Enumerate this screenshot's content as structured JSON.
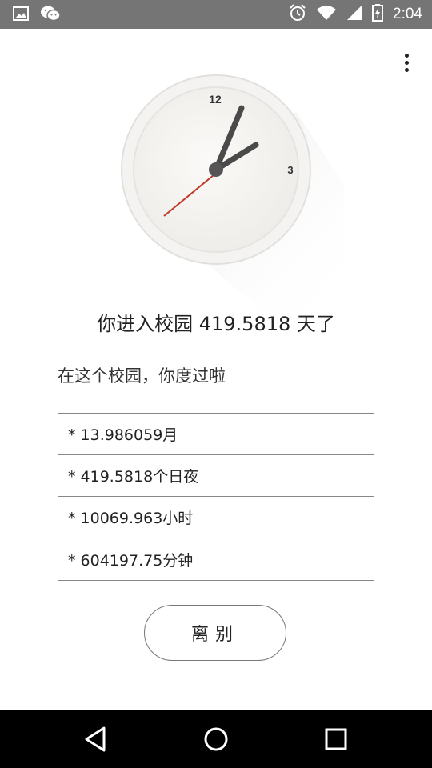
{
  "status_bar": {
    "time": "2:04",
    "left_icons": [
      "image-icon",
      "wechat-icon"
    ],
    "right_icons": [
      "alarm-icon",
      "wifi-icon",
      "signal-icon",
      "battery-charging-icon"
    ]
  },
  "menu": {
    "icon": "more-vert-icon"
  },
  "clock": {
    "label_12": "12",
    "label_3": "3"
  },
  "headline": "你进入校园 419.5818 天了",
  "subhead": "在这个校园，你度过啦",
  "stats": [
    "* 13.986059月",
    "* 419.5818个日夜",
    "* 10069.963小时",
    "* 604197.75分钟"
  ],
  "leave_button": "离别",
  "nav": {
    "icons": [
      "back-icon",
      "home-icon",
      "recents-icon"
    ]
  },
  "colors": {
    "status_bar": "#757575",
    "second_hand": "#c0392b",
    "hands": "#4a4a4a"
  }
}
